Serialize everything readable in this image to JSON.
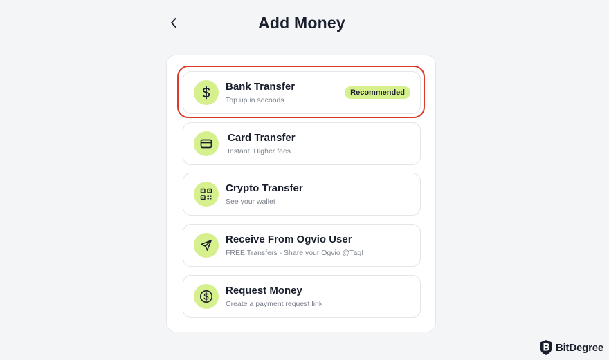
{
  "header": {
    "title": "Add Money",
    "back_icon": "chevron-left-icon"
  },
  "options": [
    {
      "label": "Bank Transfer",
      "sublabel": "Top up in seconds",
      "icon": "dollar-icon",
      "badge": "Recommended"
    },
    {
      "label": "Card Transfer",
      "sublabel": "Instant. Higher fees",
      "icon": "credit-card-icon"
    },
    {
      "label": "Crypto Transfer",
      "sublabel": "See your wallet",
      "icon": "qr-code-icon"
    },
    {
      "label": "Receive From Ogvio User",
      "sublabel": "FREE Transfers - Share your Ogvio @Tag!",
      "icon": "send-icon"
    },
    {
      "label": "Request Money",
      "sublabel": "Create a payment request link",
      "icon": "dollar-circle-icon"
    }
  ],
  "watermark": {
    "text": "BitDegree"
  },
  "colors": {
    "accent": "#d6f08d",
    "highlight": "#d93a2b",
    "text": "#1a1f2e",
    "muted": "#7b808b"
  }
}
